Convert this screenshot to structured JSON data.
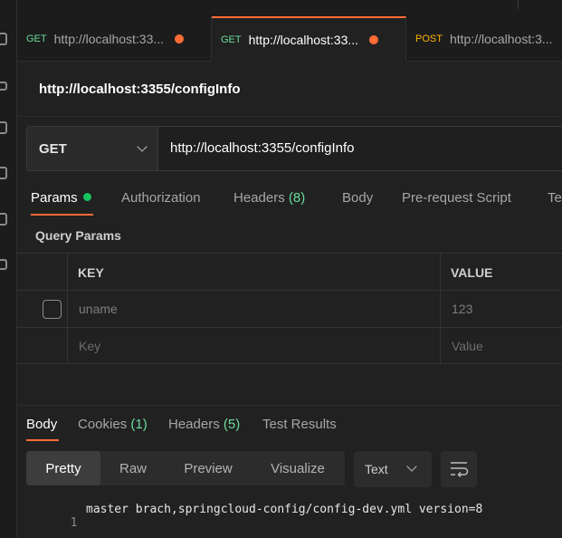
{
  "tabs": [
    {
      "method": "GET",
      "url": "http://localhost:33...",
      "unsaved": true,
      "active": false
    },
    {
      "method": "GET",
      "url": "http://localhost:33...",
      "unsaved": true,
      "active": true
    },
    {
      "method": "POST",
      "url": "http://localhost:3...",
      "unsaved": false,
      "active": false
    }
  ],
  "request": {
    "title": "http://localhost:3355/configInfo",
    "method": "GET",
    "url": "http://localhost:3355/configInfo"
  },
  "request_tabs": {
    "params": "Params",
    "authorization": "Authorization",
    "headers": "Headers",
    "headers_count": "(8)",
    "body": "Body",
    "prerequest": "Pre-request Script",
    "tests": "Te"
  },
  "query_params": {
    "title": "Query Params",
    "col_key": "KEY",
    "col_value": "VALUE",
    "rows": [
      {
        "key": "uname",
        "value": "123"
      }
    ],
    "key_placeholder": "Key",
    "value_placeholder": "Value"
  },
  "response_tabs": {
    "body": "Body",
    "cookies": "Cookies",
    "cookies_count": "(1)",
    "headers": "Headers",
    "headers_count": "(5)",
    "test_results": "Test Results"
  },
  "view_modes": [
    "Pretty",
    "Raw",
    "Preview",
    "Visualize"
  ],
  "format": "Text",
  "response_body": {
    "line_number": "1",
    "content": "master brach,springcloud-config/config-dev.yml version=8"
  },
  "colors": {
    "accent": "#ff6c37",
    "get": "#6bdd9a",
    "post": "#ffb400",
    "count": "#6bdd9a"
  }
}
